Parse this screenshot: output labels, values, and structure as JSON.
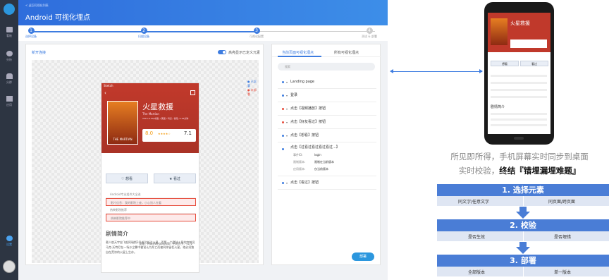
{
  "sidebar": {
    "items": [
      {
        "label": "看板"
      },
      {
        "label": "分析"
      },
      {
        "label": "分群"
      },
      {
        "label": "应用"
      }
    ],
    "settings": "设置"
  },
  "header": {
    "back": "< 返回可视化列表",
    "title": "Android 可视化埋点"
  },
  "steps": [
    {
      "n": "1",
      "label": "选择设备"
    },
    {
      "n": "2",
      "label": "扫描设备"
    },
    {
      "n": "3",
      "label": "可视化配置"
    },
    {
      "n": "4",
      "label": "测试 & 部署"
    }
  ],
  "left_panel": {
    "new_link": "新开连接",
    "toggle_label": "高亮显示已定义元素",
    "legend": [
      "已部署",
      "未部署"
    ]
  },
  "phone": {
    "status": "Sketch",
    "title": "火星救援",
    "subtitle": "The Martian",
    "meta": "2015-9-30(中国) / 美国 / 科幻 / 冒险 / 144分钟",
    "score": "8.0",
    "stars": "★★★★☆",
    "rank": "7.1",
    "book_label": "THE MARTIAN",
    "btn_want": "想看",
    "btn_seen": "看过",
    "rows": [
      "Android专业组件大全进",
      "影片信息：我的影院上座，小心别人先看",
      "热映影院推荐",
      "热映影院推荐中"
    ],
    "section_title": "剧情简介",
    "summary": "载人航天宇宙飞船阿瑞斯3号成功抵达火星，而第一个登陆火星的宇航员马克·沃特尼在一场沙尘暴中被误认为死亡而被同伴留在火星。他必须独自在荒凉的火星上生存。",
    "footer": "设备：MateWHatsoown\n空间大小：v1.1"
  },
  "right_panel": {
    "tabs": [
      "当前页面可视化埋点",
      "所有可视化埋点"
    ],
    "search_placeholder": "搜索",
    "items": [
      {
        "label": "Landing page",
        "color": "#3d7ce0"
      },
      {
        "label": "登录",
        "color": "#3d7ce0"
      },
      {
        "label": "点击【视频播放】按钮",
        "color": "#e74c3c"
      },
      {
        "label": "点击【好友看过】按钮",
        "color": "#e74c3c"
      },
      {
        "label": "点击【想看】按钮",
        "color": "#3d7ce0"
      }
    ],
    "detail": {
      "title": "点击【过看过看过看过看过...】",
      "fields": [
        {
          "k": "事件ID:",
          "v": "login"
        },
        {
          "k": "限制版本:",
          "v": "限制在当前版本"
        },
        {
          "k": "应用版本:",
          "v": "仅当前版本"
        }
      ]
    },
    "last_item": "点击【看过】按钮",
    "deploy": "部署"
  },
  "caption": {
    "line1": "所见即所得，手机屏幕实时同步到桌面",
    "line2_a": "实时校验，",
    "line2_b": "终结『错埋漏埋难题』"
  },
  "flow": [
    {
      "title": "1. 选择元素",
      "left": "同文字/任意文字",
      "right": "同页面/跨页面"
    },
    {
      "title": "2. 校验",
      "left": "是否生效",
      "right": "是否埋错"
    },
    {
      "title": "3. 部署",
      "left": "全部版本",
      "right": "单一版本"
    }
  ],
  "colors": {
    "accent": "#3d7ce0",
    "flow": "#4a7dd6",
    "hero": "#c0392b"
  }
}
